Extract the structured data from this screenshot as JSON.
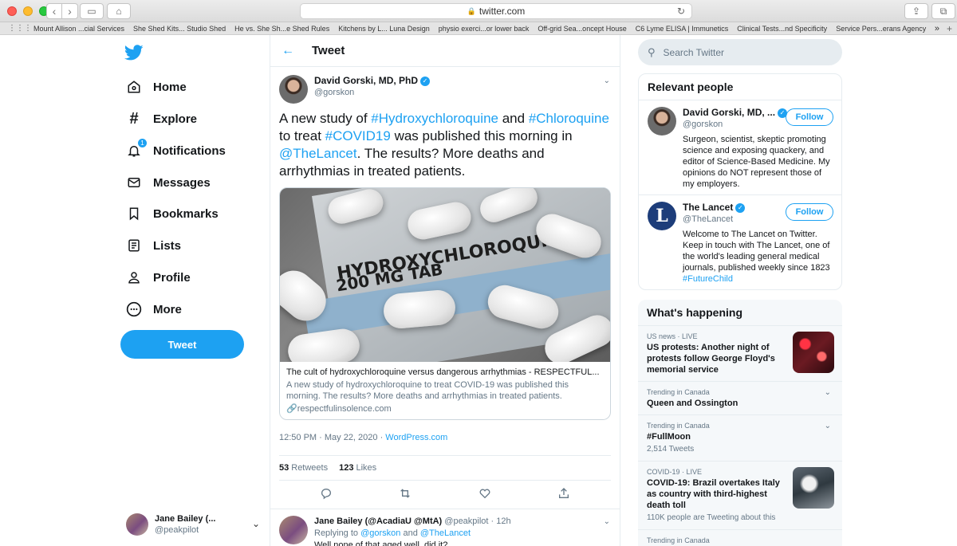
{
  "browser": {
    "url": "twitter.com",
    "bookmarks": [
      "Mount Allison ...cial Services",
      "She Shed Kits... Studio Shed",
      "He vs. She Sh...e Shed Rules",
      "Kitchens by L... Luna Design",
      "physio exerci...or lower back",
      "Off-grid Sea...oncept House",
      "C6 Lyme ELISA | Immunetics",
      "Clinical Tests...nd Specificity",
      "Service Pers...erans Agency"
    ]
  },
  "nav": {
    "items": [
      {
        "label": "Home",
        "icon": "home-icon"
      },
      {
        "label": "Explore",
        "icon": "hash-icon"
      },
      {
        "label": "Notifications",
        "icon": "bell-icon",
        "badge": "1"
      },
      {
        "label": "Messages",
        "icon": "mail-icon"
      },
      {
        "label": "Bookmarks",
        "icon": "bookmark-icon"
      },
      {
        "label": "Lists",
        "icon": "list-icon"
      },
      {
        "label": "Profile",
        "icon": "person-icon"
      },
      {
        "label": "More",
        "icon": "more-icon"
      }
    ],
    "tweet_button": "Tweet",
    "account": {
      "name": "Jane Bailey (...",
      "handle": "@peakpilot"
    }
  },
  "main": {
    "header": "Tweet",
    "tweet": {
      "name": "David Gorski, MD, PhD",
      "handle": "@gorskon",
      "text_parts": [
        "A new study of ",
        "#Hydroxychloroquine",
        " and ",
        "#Chloroquine",
        " to treat ",
        "#COVID19",
        " was published this morning in ",
        "@TheLancet",
        ". The results? More deaths and arrhythmias in treated patients."
      ],
      "card": {
        "image_text_1": "HYDROXYCHLOROQUINE",
        "image_text_2": "200 MG TAB",
        "title": "The cult of hydroxychloroquine versus dangerous arrhythmias - RESPECTFUL...",
        "description": "A new study of hydroxychloroquine to treat COVID-19 was published this morning. The results? More deaths and arrhythmias in treated patients.",
        "url": "respectfulinsolence.com"
      },
      "timestamp": "12:50 PM · May 22, 2020 · ",
      "source": "WordPress.com",
      "retweets": "53",
      "retweets_label": "Retweets",
      "likes": "123",
      "likes_label": "Likes"
    },
    "reply": {
      "name": "Jane Bailey (@AcadiaU @MtA)",
      "handle": "@peakpilot",
      "time": "· 12h",
      "replying_prefix": "Replying to ",
      "replying_to_1": "@gorskon",
      "replying_and": " and ",
      "replying_to_2": "@TheLancet",
      "text": "Well none of that aged well, did it?"
    }
  },
  "right": {
    "search_placeholder": "Search Twitter",
    "relevant": {
      "title": "Relevant people",
      "people": [
        {
          "name": "David Gorski, MD, ...",
          "handle": "@gorskon",
          "bio": "Surgeon, scientist, skeptic promoting science and exposing quackery, and editor of Science-Based Medicine. My opinions do NOT represent those of my employers.",
          "follow": "Follow"
        },
        {
          "name": "The Lancet",
          "handle": "@TheLancet",
          "bio": "Welcome to The Lancet on Twitter. Keep in touch with The Lancet, one of the world's leading general medical journals, published weekly since 1823",
          "bio_link": "#FutureChild",
          "follow": "Follow",
          "logo_letter": "L"
        }
      ]
    },
    "happening": {
      "title": "What's happening",
      "trends": [
        {
          "context": "US news · LIVE",
          "title": "US protests: Another night of protests follow George Floyd's memorial service"
        },
        {
          "context": "Trending in Canada",
          "title": "Queen and Ossington"
        },
        {
          "context": "Trending in Canada",
          "title": "#FullMoon",
          "count": "2,514 Tweets"
        },
        {
          "context": "COVID-19 · LIVE",
          "title": "COVID-19: Brazil overtakes Italy as country with third-highest death toll",
          "count": "110K people are Tweeting about this"
        },
        {
          "context": "Trending in Canada"
        }
      ]
    }
  }
}
